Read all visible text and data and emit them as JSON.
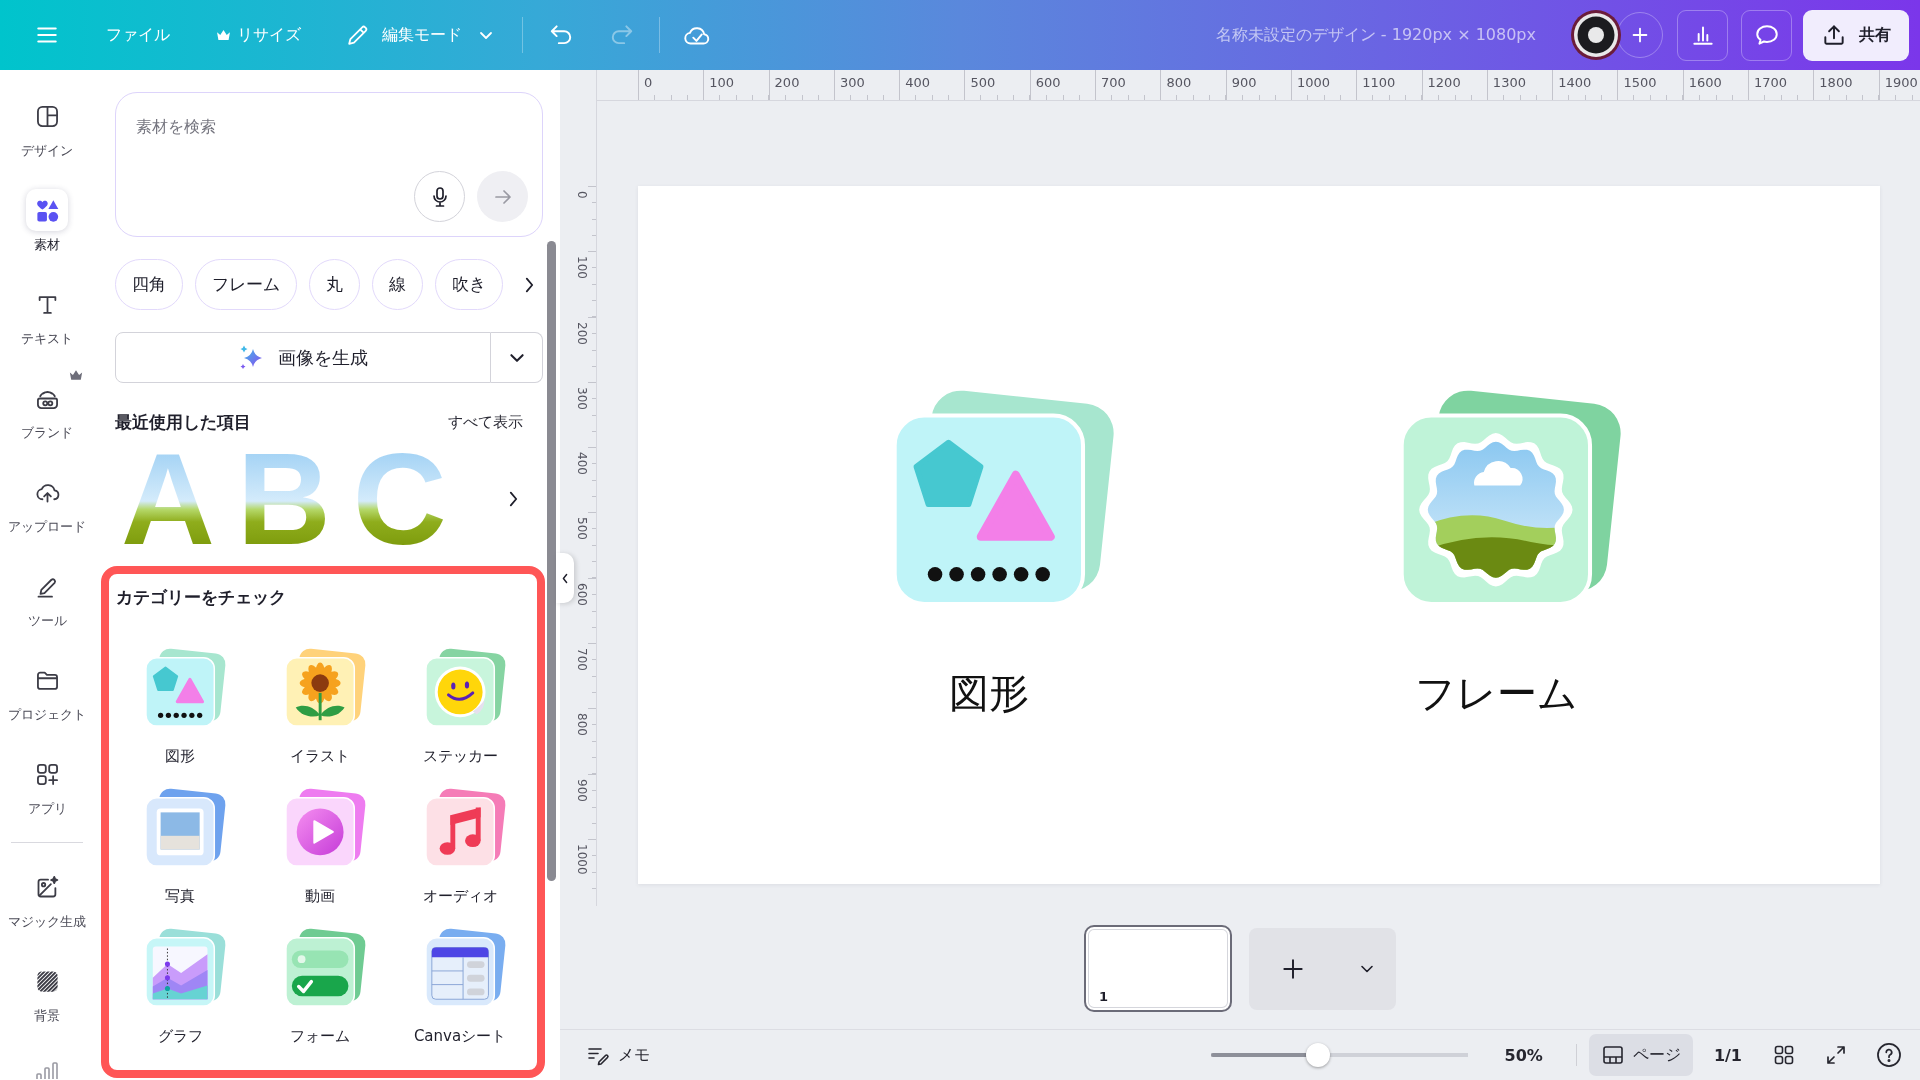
{
  "toolbar": {
    "file_menu": "ファイル",
    "resize": {
      "label": "リサイズ",
      "premium": true
    },
    "edit_mode": "編集モード",
    "undo": {
      "disabled": false
    },
    "redo": {
      "disabled": true
    },
    "document_title": "名称未設定のデザイン - 1920px × 1080px",
    "share": "共有"
  },
  "sidebar": {
    "items": [
      {
        "kind": "design",
        "label": "デザイン",
        "selected": false,
        "premium": false
      },
      {
        "kind": "elements",
        "label": "素材",
        "selected": true,
        "premium": false
      },
      {
        "kind": "text",
        "label": "テキスト",
        "selected": false,
        "premium": false
      },
      {
        "kind": "brand",
        "label": "ブランド",
        "selected": false,
        "premium": true
      },
      {
        "kind": "uploads",
        "label": "アップロード",
        "selected": false,
        "premium": false
      },
      {
        "kind": "tools",
        "label": "ツール",
        "selected": false,
        "premium": false
      },
      {
        "kind": "projects",
        "label": "プロジェクト",
        "selected": false,
        "premium": false
      },
      {
        "kind": "apps",
        "label": "アプリ",
        "selected": false,
        "premium": false
      }
    ],
    "extra_items": [
      {
        "kind": "magic",
        "label": "マジック生成",
        "selected": false,
        "premium": false
      },
      {
        "kind": "background",
        "label": "背景",
        "selected": false,
        "premium": false
      }
    ]
  },
  "panel": {
    "search": {
      "placeholder": "素材を検索"
    },
    "chips": [
      "四角",
      "フレーム",
      "丸",
      "線",
      "吹き"
    ],
    "generate_button": "画像を生成",
    "recent": {
      "title": "最近使用した項目",
      "see_all": "すべて表示",
      "items": [
        "A",
        "B",
        "C"
      ]
    },
    "categories": {
      "title": "カテゴリーをチェック",
      "highlighted": true,
      "items": [
        {
          "kind": "shapes",
          "label": "図形"
        },
        {
          "kind": "illustration",
          "label": "イラスト"
        },
        {
          "kind": "sticker",
          "label": "ステッカー"
        },
        {
          "kind": "photo",
          "label": "写真"
        },
        {
          "kind": "video",
          "label": "動画"
        },
        {
          "kind": "audio",
          "label": "オーディオ"
        },
        {
          "kind": "chart",
          "label": "グラフ"
        },
        {
          "kind": "form",
          "label": "フォーム"
        },
        {
          "kind": "sheet",
          "label": "Canvaシート"
        }
      ]
    }
  },
  "canvas": {
    "rulers": {
      "horizontal": [
        "0",
        "100",
        "200",
        "300",
        "400",
        "500",
        "600",
        "700",
        "800",
        "900",
        "1000",
        "1100",
        "1200",
        "1300",
        "1400",
        "1500",
        "1600",
        "1700",
        "1800",
        "1900"
      ],
      "vertical": [
        "0",
        "100",
        "200",
        "300",
        "400",
        "500",
        "600",
        "700",
        "800",
        "900",
        "1000"
      ]
    },
    "page_items": [
      {
        "kind": "shapes",
        "label": "図形"
      },
      {
        "kind": "frame",
        "label": "フレーム"
      }
    ],
    "pages": [
      {
        "number": "1",
        "selected": true
      }
    ]
  },
  "status_bar": {
    "notes": "メモ",
    "zoom": {
      "level": 0.41,
      "reading": "50%"
    },
    "view": {
      "label": "ページ",
      "selected": true
    },
    "page_count": "1/1"
  }
}
